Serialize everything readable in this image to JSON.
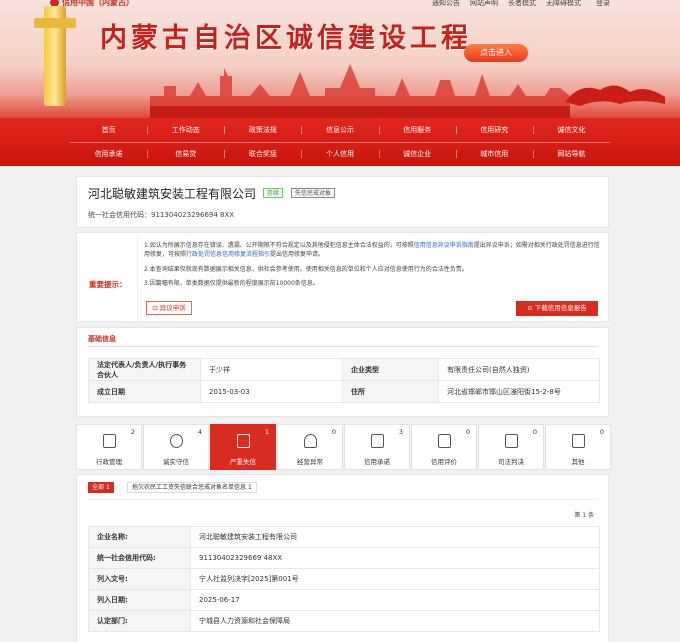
{
  "banner": {
    "logo": "信用中国（内蒙古）",
    "top_links": [
      "通知公告",
      "网站声明",
      "长者模式",
      "无障碍模式",
      "登录"
    ],
    "title": "内蒙古自治区诚信建设工程",
    "enter_button": "点击进入"
  },
  "nav": {
    "row1": [
      "首页",
      "工作动态",
      "政策法规",
      "信息公示",
      "信用服务",
      "信用研究",
      "诚信文化"
    ],
    "row2": [
      "信用承诺",
      "信易贷",
      "联合奖惩",
      "个人信用",
      "诚信企业",
      "城市信用",
      "网站导航"
    ]
  },
  "company": {
    "name": "河北聪敏建筑安装工程有限公司",
    "tag_status": "存续",
    "tag_punish": "失信惩戒对象",
    "credit_code_label": "统一社会信用代码：",
    "credit_code": "911304023296694 8XX"
  },
  "notice": {
    "label": "重要提示：",
    "line1": "1.如认为所展示信息存在错误、遗漏、公开期限不符合规定以及其他侵犯信息主体合法权益的，可按照",
    "line1_link": "信用信息异议申诉指南",
    "line1_end": "提出异议申诉；如需对相关行政处罚信息进行信用修复，可按照",
    "line1_link2": "行政处罚信息信用修复流程指引",
    "line1_end2": "提出信用修复申请。",
    "line2": "2.本查询结果仅就现有数据展示相关信息，供社会参考使用。使用相关信息的单位和个人应对信息使用行为的合法性负责。",
    "line3": "3.因篇幅有限，单类数据仅提供最新的程度展示前10000条信息。",
    "appeal_button": "异议申诉",
    "download_button": "下载信用信息报告"
  },
  "basic": {
    "title": "基础信息",
    "legal_rep_label": "法定代表人/负责人/执行事务合伙人",
    "legal_rep": "于少祥",
    "type_label": "企业类型",
    "type": "有限责任公司(自然人独资)",
    "est_label": "成立日期",
    "est": "2015-03-03",
    "addr_label": "住所",
    "addr": "河北省邯郸市邯山区滏阳街15-2-8号"
  },
  "tabs": [
    {
      "label": "行政管理",
      "count": "2"
    },
    {
      "label": "诚实守信",
      "count": "4"
    },
    {
      "label": "严重失信",
      "count": "1"
    },
    {
      "label": "经营异常",
      "count": "0"
    },
    {
      "label": "信用承诺",
      "count": "3"
    },
    {
      "label": "信用评价",
      "count": "0"
    },
    {
      "label": "司法判决",
      "count": "0"
    },
    {
      "label": "其他",
      "count": "0"
    }
  ],
  "records": {
    "filter_all": "全部",
    "filter_all_count": "1",
    "filter_item": "拖欠农民工工资失信联合惩戒对象名单信息",
    "filter_item_count": "1",
    "count_text": "第 1 条",
    "rows": [
      {
        "label": "企业名称:",
        "value": "河北聪敏建筑安装工程有限公司"
      },
      {
        "label": "统一社会信用代码:",
        "value": "91130402329669 48XX"
      },
      {
        "label": "列入文号:",
        "value": "宁人社监列决字[2025]第001号"
      },
      {
        "label": "列入日期:",
        "value": "2025-06-17"
      },
      {
        "label": "认定部门:",
        "value": "宁城县人力资源和社会保障局"
      }
    ]
  }
}
